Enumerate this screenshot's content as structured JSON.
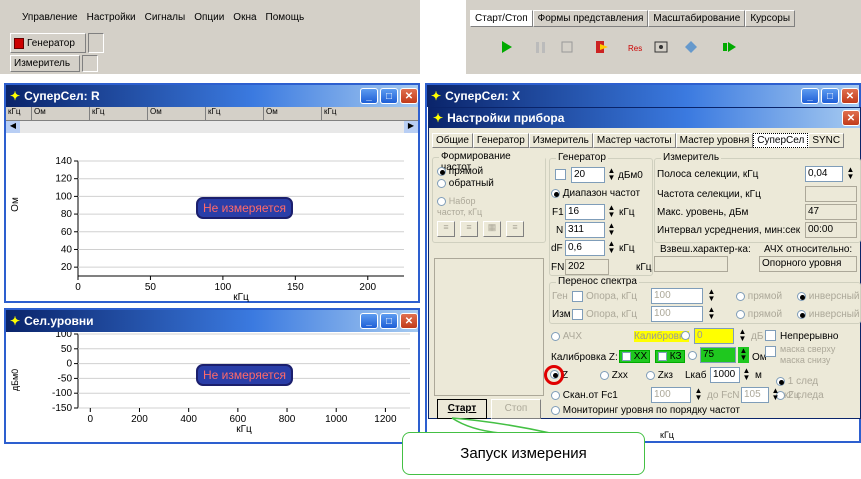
{
  "menu": [
    "Управление",
    "Настройки",
    "Сигналы",
    "Опции",
    "Окна",
    "Помощь"
  ],
  "generator_label": "Генератор",
  "meter_label": "Измеритель",
  "top_tabs": [
    "Старт/Стоп",
    "Формы представления",
    "Масштабирование",
    "Курсоры"
  ],
  "win1": {
    "title": "СуперСел: R",
    "tabs": [
      "кГц",
      "Ом",
      "кГц",
      "Ом",
      "кГц",
      "Ом",
      "кГц"
    ],
    "ylabel": "Ом",
    "xlabel": "кГц",
    "status": "Не измеряется"
  },
  "win2": {
    "title": "Сел.уровни",
    "ylabel": "дБм0",
    "xlabel": "кГц",
    "status": "Не измеряется"
  },
  "win3": {
    "title": "СуперСел: X"
  },
  "dialog": {
    "title": "Настройки прибора",
    "tabs": [
      "Общие",
      "Генератор",
      "Измеритель",
      "Мастер частоты",
      "Мастер уровня",
      "СуперСел",
      "SYNC"
    ],
    "freq_group": "Формирование частот",
    "direct": "прямой",
    "reverse": "обратный",
    "set_freq": "Набор частот, кГц",
    "gen_group": "Генератор",
    "gen_level": "20",
    "dbm0": "дБм0",
    "range_label": "Диапазон частот",
    "f1_label": "F1",
    "f1": "16",
    "khz": "кГц",
    "n_label": "N",
    "n": "311",
    "df_label": "dF",
    "df": "0,6",
    "fn_label": "FN",
    "fn": "202",
    "meas_group": "Измеритель",
    "sel_band": "Полоса селекции, кГц",
    "sel_band_val": "0,04",
    "sel_freq": "Частота селекции, кГц",
    "max_level": "Макс. уровень, дБм",
    "max_level_val": "47",
    "avg": "Интервал усреднения, мин:сек",
    "avg_val": "00:00",
    "weighted": "Взвеш.характер-ка:",
    "afc_rel": "АЧХ относительно:",
    "afc_rel_val": "Опорного уровня",
    "transfer": "Перенос спектра",
    "gen_short": "Ген",
    "izm_short": "Изм",
    "ref_khz": "Опора, кГц",
    "ref1": "100",
    "ref2": "100",
    "prymoy": "прямой",
    "inverse": "инверсный",
    "ach": "АЧХ",
    "calib": "Калибровка",
    "calib_val": "0",
    "db": "дБ",
    "continuous": "Непрерывно",
    "calib_z": "Калибровка Z:",
    "xx": "XX",
    "kz": "КЗ",
    "z_val": "75",
    "ohm": "Ом",
    "mask_up": "маска сверху",
    "mask_down": "маска снизу",
    "z": "Z",
    "zxx": "Zxx",
    "zkz": "Zкз",
    "lcab": "Lкаб",
    "lcab_val": "1000",
    "m": "м",
    "trace1": "1 след",
    "trace2": "2 следа",
    "scan": "Скан.от Fс1",
    "scan_from": "100",
    "to_fcn": "до FcN",
    "scan_to": "105",
    "khz2": "кГц",
    "monitor": "Мониторинг уровня по порядку частот",
    "start": "Старт",
    "stop": "Стоп"
  },
  "callout": "Запуск измерения",
  "chart_data": [
    {
      "type": "line",
      "xlim": [
        0,
        225
      ],
      "ylim": [
        10,
        140
      ],
      "xticks": [
        0,
        50,
        100,
        150,
        200
      ],
      "yticks": [
        20,
        40,
        60,
        80,
        100,
        120,
        140
      ],
      "ylabel": "Ом",
      "xlabel": "кГц",
      "series": []
    },
    {
      "type": "line",
      "xlim": [
        -50,
        1300
      ],
      "ylim": [
        -150,
        100
      ],
      "xticks": [
        0,
        200,
        400,
        600,
        800,
        1000,
        1200
      ],
      "yticks": [
        -150,
        -100,
        -50,
        0,
        50,
        100
      ],
      "ylabel": "дБм0",
      "xlabel": "кГц",
      "series": []
    }
  ],
  "colors": {
    "accent": "#0a246a",
    "status_bg": "#2a3ea8",
    "status_fg": "#ff6a6a",
    "highlight": "#e00000",
    "callout": "#44c044",
    "green": "#1fc81f"
  }
}
